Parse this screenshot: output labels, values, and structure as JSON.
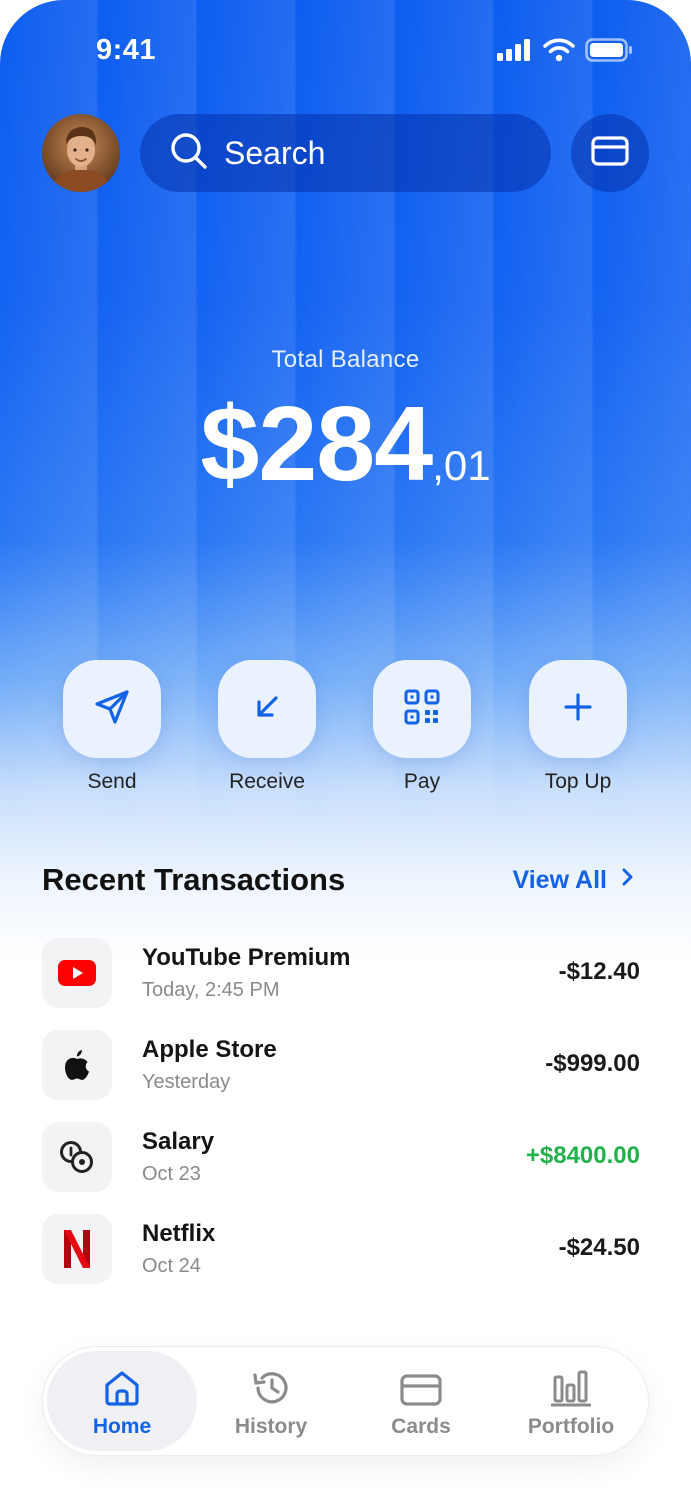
{
  "status_bar": {
    "time": "9:41"
  },
  "header": {
    "search_placeholder": "Search",
    "avatar_icon": "user-avatar",
    "card_icon": "credit-card-icon"
  },
  "balance": {
    "label": "Total Balance",
    "amount": "$284",
    "cents": ",01"
  },
  "actions": [
    {
      "label": "Send",
      "icon": "send-icon"
    },
    {
      "label": "Receive",
      "icon": "receive-arrow-icon"
    },
    {
      "label": "Pay",
      "icon": "qr-code-icon"
    },
    {
      "label": "Top Up",
      "icon": "plus-icon"
    }
  ],
  "transactions": {
    "title": "Recent Transactions",
    "view_all": "View All",
    "items": [
      {
        "name": "YouTube Premium",
        "date": "Today, 2:45 PM",
        "amount": "-$12.40",
        "icon": "youtube-icon"
      },
      {
        "name": "Apple Store",
        "date": "Yesterday",
        "amount": "-$999.00",
        "icon": "apple-icon"
      },
      {
        "name": "Salary",
        "date": "Oct 23",
        "amount": "+$8400.00",
        "icon": "coins-icon"
      },
      {
        "name": "Netflix",
        "date": "Oct 24",
        "amount": "-$24.50",
        "icon": "netflix-icon"
      }
    ]
  },
  "tabbar": {
    "tabs": [
      {
        "label": "Home",
        "icon": "home-icon",
        "active": true
      },
      {
        "label": "History",
        "icon": "history-icon",
        "active": false
      },
      {
        "label": "Cards",
        "icon": "card-icon",
        "active": false
      },
      {
        "label": "Portfolio",
        "icon": "chart-icon",
        "active": false
      }
    ]
  },
  "colors": {
    "primary_blue": "#0d5df0",
    "accent_blue": "#1463e6",
    "positive_green": "#21b24b",
    "youtube_red": "#ff0000",
    "netflix_red": "#e50914"
  }
}
